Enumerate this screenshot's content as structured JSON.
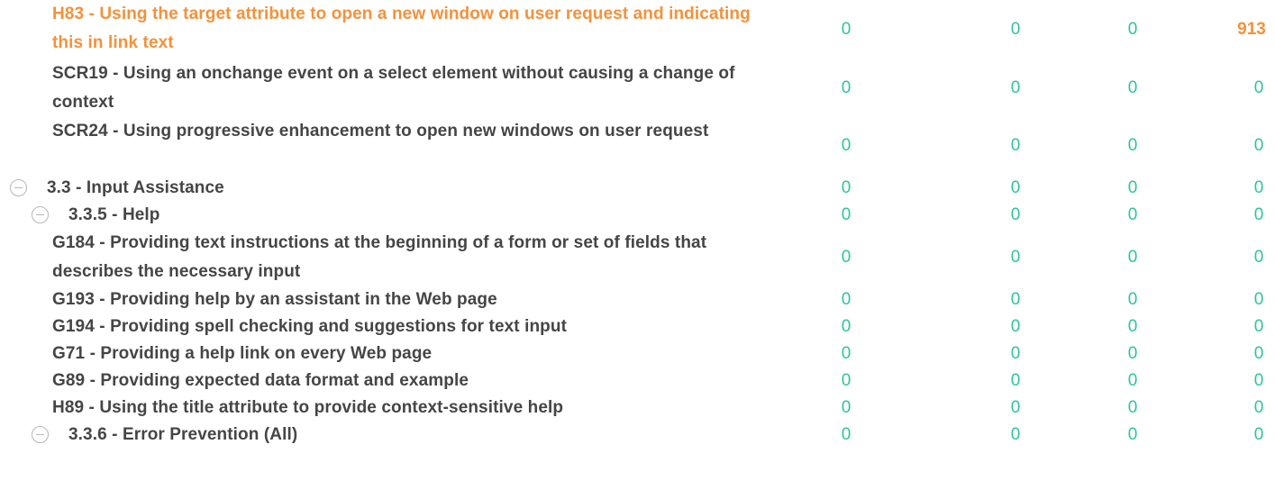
{
  "colors": {
    "label": "#454545",
    "highlight": "#f5913a",
    "value": "#2ec59b",
    "toggle": "#b7b7b7"
  },
  "rows": [
    {
      "level": "technique",
      "highlight": true,
      "label": "H83 - Using the target attribute to open a new window on user request and indicating this in link text",
      "values": [
        "0",
        "0",
        "0",
        "913"
      ]
    },
    {
      "level": "technique",
      "label": "SCR19 - Using an onchange event on a select element without causing a change of context",
      "values": [
        "0",
        "0",
        "0",
        "0"
      ]
    },
    {
      "level": "technique",
      "label": "SCR24 - Using progressive enhancement to open new windows on user request",
      "values": [
        "0",
        "0",
        "0",
        "0"
      ]
    },
    {
      "level": "guideline",
      "toggle_icon": "collapse-circle-icon",
      "label": "3.3 - Input Assistance",
      "values": [
        "0",
        "0",
        "0",
        "0"
      ]
    },
    {
      "level": "criterion",
      "toggle_icon": "collapse-circle-icon",
      "label": "3.3.5 - Help",
      "values": [
        "0",
        "0",
        "0",
        "0"
      ]
    },
    {
      "level": "technique",
      "label": "G184 - Providing text instructions at the beginning of a form or set of fields that describes the necessary input",
      "values": [
        "0",
        "0",
        "0",
        "0"
      ]
    },
    {
      "level": "technique",
      "label": "G193 - Providing help by an assistant in the Web page",
      "values": [
        "0",
        "0",
        "0",
        "0"
      ]
    },
    {
      "level": "technique",
      "label": "G194 - Providing spell checking and suggestions for text input",
      "values": [
        "0",
        "0",
        "0",
        "0"
      ]
    },
    {
      "level": "technique",
      "label": "G71 - Providing a help link on every Web page",
      "values": [
        "0",
        "0",
        "0",
        "0"
      ]
    },
    {
      "level": "technique",
      "label": "G89 - Providing expected data format and example",
      "values": [
        "0",
        "0",
        "0",
        "0"
      ]
    },
    {
      "level": "technique",
      "label": "H89 - Using the title attribute to provide context-sensitive help",
      "values": [
        "0",
        "0",
        "0",
        "0"
      ]
    },
    {
      "level": "criterion",
      "toggle_icon": "collapse-circle-icon",
      "label": "3.3.6 - Error Prevention (All)",
      "values": [
        "0",
        "0",
        "0",
        "0"
      ]
    }
  ]
}
